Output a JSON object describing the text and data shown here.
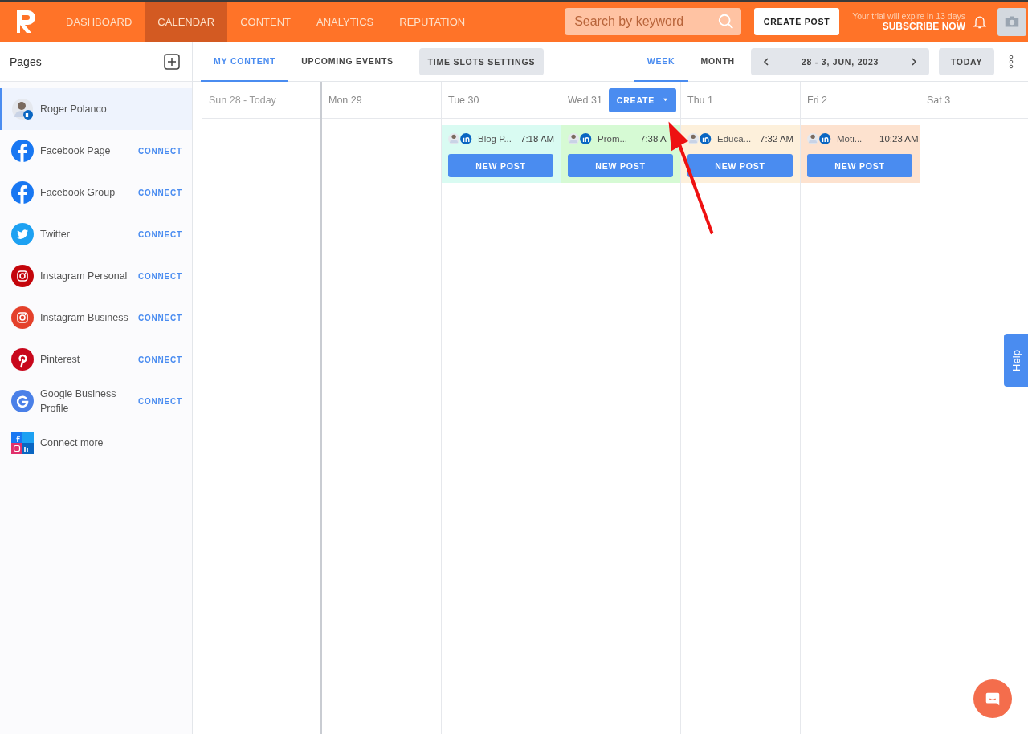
{
  "nav": {
    "tabs": [
      {
        "label": "DASHBOARD",
        "selected": false
      },
      {
        "label": "CALENDAR",
        "selected": true
      },
      {
        "label": "CONTENT",
        "selected": false
      },
      {
        "label": "ANALYTICS",
        "selected": false
      },
      {
        "label": "REPUTATION",
        "selected": false
      }
    ],
    "search": {
      "placeholder": "Search by keyword"
    },
    "create_post": "CREATE POST",
    "trial": "Your trial will expire in 13 days",
    "subscribe": "SUBSCRIBE NOW"
  },
  "sidebar": {
    "title": "Pages",
    "items": [
      {
        "kind": "account",
        "label": "Roger Polanco",
        "selected": true
      },
      {
        "kind": "facebook",
        "label": "Facebook Page",
        "action": "CONNECT",
        "selected": false,
        "color": "#1877f2"
      },
      {
        "kind": "facebook",
        "label": "Facebook Group",
        "action": "CONNECT",
        "selected": false,
        "color": "#1877f2"
      },
      {
        "kind": "twitter",
        "label": "Twitter",
        "action": "CONNECT",
        "selected": false,
        "color": "#1da1f2"
      },
      {
        "kind": "instagram",
        "label": "Instagram Personal",
        "action": "CONNECT",
        "selected": false,
        "color": "#c4050b"
      },
      {
        "kind": "instagram",
        "label": "Instagram Business",
        "action": "CONNECT",
        "selected": false,
        "color": "#e4412b"
      },
      {
        "kind": "pinterest",
        "label": "Pinterest",
        "action": "CONNECT",
        "selected": false,
        "color": "#c8071c"
      },
      {
        "kind": "google",
        "label": "Google Business Profile",
        "action": "CONNECT",
        "selected": false,
        "color": "#4a80e8"
      },
      {
        "kind": "more",
        "label": "Connect more",
        "selected": false
      }
    ]
  },
  "toolbar": {
    "tabs": [
      {
        "label": "MY CONTENT",
        "selected": true
      },
      {
        "label": "UPCOMING EVENTS",
        "selected": false
      }
    ],
    "time_slots": "TIME SLOTS SETTINGS",
    "views": [
      {
        "label": "WEEK",
        "selected": true
      },
      {
        "label": "MONTH",
        "selected": false
      }
    ],
    "date_range": "28 - 3, JUN, 2023",
    "today": "TODAY"
  },
  "calendar": {
    "days": [
      {
        "label": "Sun 28 - Today",
        "today": true
      },
      {
        "label": "Mon 29",
        "today": false
      },
      {
        "label": "Tue 30",
        "today": false,
        "events": [
          {
            "title": "Blog P...",
            "time": "7:18 AM",
            "color": "#d9fbf2",
            "button": "NEW POST"
          }
        ]
      },
      {
        "label": "Wed 31",
        "today": false,
        "create": "CREATE",
        "events": [
          {
            "title": "Prom...",
            "time": "7:38 A",
            "color": "#d6fad4",
            "button": "NEW POST"
          }
        ]
      },
      {
        "label": "Thu 1",
        "today": false,
        "events": [
          {
            "title": "Educa...",
            "time": "7:32 AM",
            "color": "#fdf0db",
            "button": "NEW POST"
          }
        ]
      },
      {
        "label": "Fri 2",
        "today": false,
        "events": [
          {
            "title": "Moti...",
            "time": "10:23 AM",
            "color": "#fde2cf",
            "button": "NEW POST"
          }
        ]
      },
      {
        "label": "Sat 3",
        "today": false
      }
    ]
  },
  "help": "Help"
}
